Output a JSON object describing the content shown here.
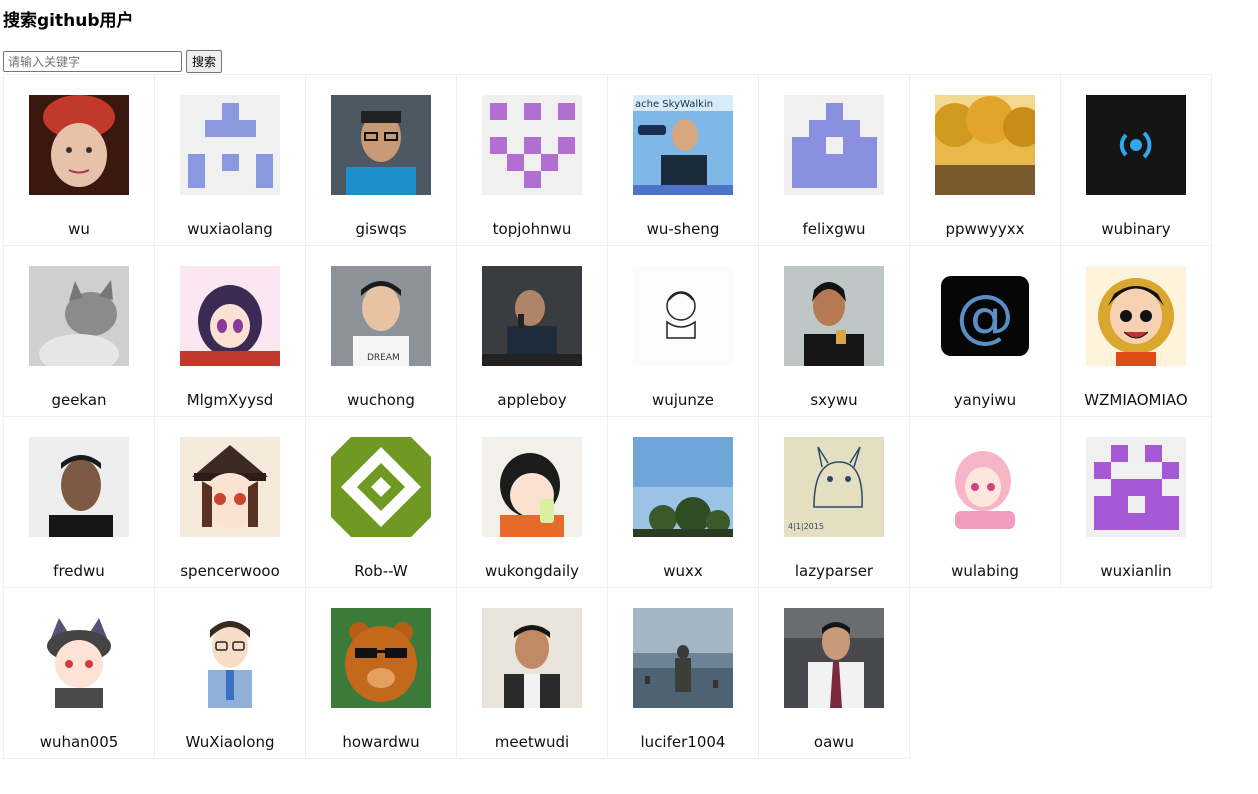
{
  "title": "搜索github用户",
  "search": {
    "placeholder": "请输入关键字",
    "value": "",
    "button_label": "搜索"
  },
  "users": [
    {
      "login": "wu",
      "avatar": "photo-child-red-hat"
    },
    {
      "login": "wuxiaolang",
      "avatar": "identicon-blue"
    },
    {
      "login": "giswqs",
      "avatar": "photo-man-glasses"
    },
    {
      "login": "topjohnwu",
      "avatar": "identicon-purple"
    },
    {
      "login": "wu-sheng",
      "avatar": "photo-speaker-stage"
    },
    {
      "login": "felixgwu",
      "avatar": "identicon-periwinkle"
    },
    {
      "login": "ppwwyyxx",
      "avatar": "photo-autumn-trees"
    },
    {
      "login": "wubinary",
      "avatar": "logo-dark-blue"
    },
    {
      "login": "geekan",
      "avatar": "photo-cat"
    },
    {
      "login": "MlgmXyysd",
      "avatar": "anime-girl"
    },
    {
      "login": "wuchong",
      "avatar": "photo-young-man"
    },
    {
      "login": "appleboy",
      "avatar": "photo-speaker-mic"
    },
    {
      "login": "wujunze",
      "avatar": "sketch-boy"
    },
    {
      "login": "sxywu",
      "avatar": "photo-woman"
    },
    {
      "login": "yanyiwu",
      "avatar": "at-sign-icon"
    },
    {
      "login": "WZMIAOMIAO",
      "avatar": "cartoon-pirate"
    },
    {
      "login": "fredwu",
      "avatar": "photo-man-dark"
    },
    {
      "login": "spencerwooo",
      "avatar": "anime-hat-girl"
    },
    {
      "login": "Rob--W",
      "avatar": "identicon-green-pattern"
    },
    {
      "login": "wukongdaily",
      "avatar": "anime-boy-drink"
    },
    {
      "login": "wuxx",
      "avatar": "photo-sky-trees"
    },
    {
      "login": "lazyparser",
      "avatar": "sketch-totoro"
    },
    {
      "login": "wulabing",
      "avatar": "anime-pink-girl"
    },
    {
      "login": "wuxianlin",
      "avatar": "identicon-violet"
    },
    {
      "login": "wuhan005",
      "avatar": "cartoon-cat-ears"
    },
    {
      "login": "WuXiaolong",
      "avatar": "cartoon-man-glasses"
    },
    {
      "login": "howardwu",
      "avatar": "illustration-bear"
    },
    {
      "login": "meetwudi",
      "avatar": "photo-smiling-man"
    },
    {
      "login": "lucifer1004",
      "avatar": "photo-soldier-beach"
    },
    {
      "login": "oawu",
      "avatar": "photo-man-tie"
    }
  ]
}
